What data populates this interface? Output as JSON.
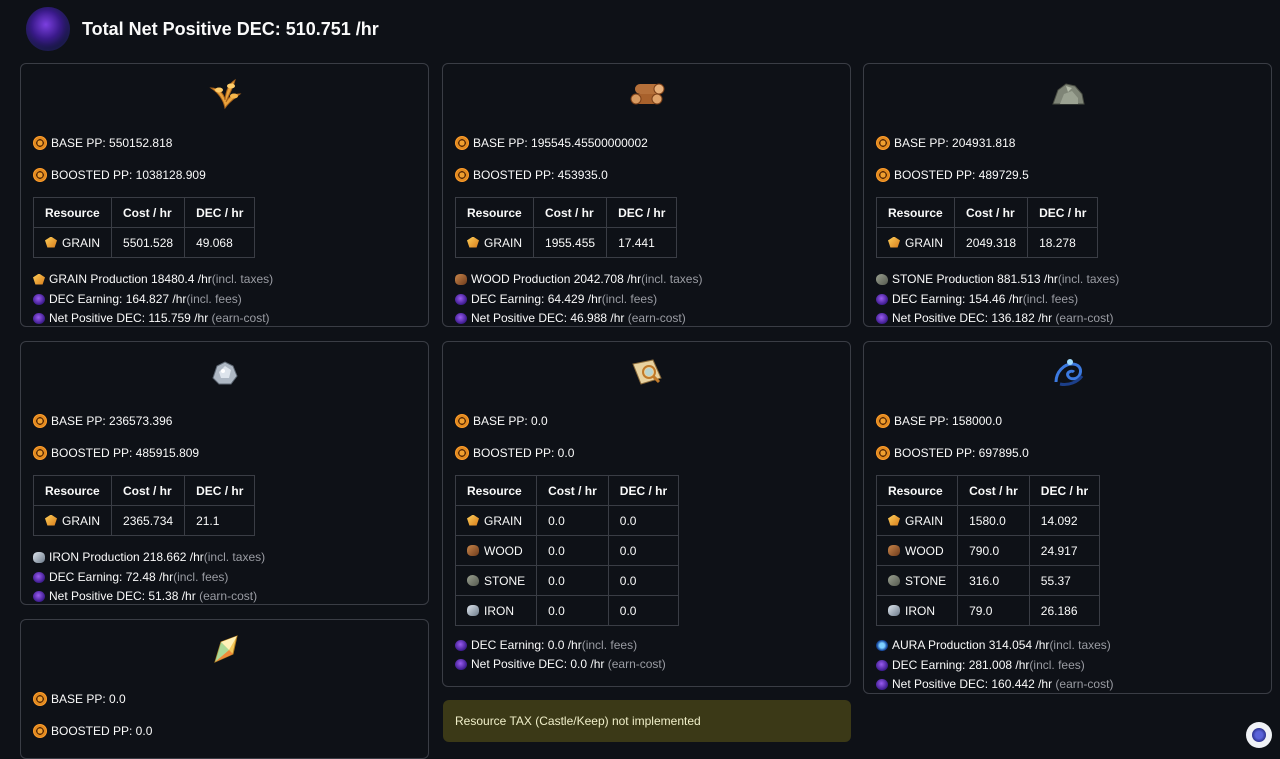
{
  "header": {
    "title": "Total Net Positive DEC: 510.751 /hr"
  },
  "table_headers": {
    "resource": "Resource",
    "cost": "Cost / hr",
    "dec": "DEC / hr"
  },
  "cards": {
    "grain": {
      "icon": "grain-icon",
      "base_pp": "BASE PP: 550152.818",
      "boosted_pp": "BOOSTED PP: 1038128.909",
      "rows": [
        {
          "resource": "GRAIN",
          "cost": "5501.528",
          "dec": "49.068"
        }
      ],
      "production": "GRAIN Production 18480.4 /hr",
      "production_note": "(incl. taxes)",
      "earning": "DEC Earning: 164.827 /hr",
      "earning_note": "(incl. fees)",
      "net": "Net Positive DEC: 115.759 /hr",
      "net_note": "(earn-cost)"
    },
    "wood": {
      "icon": "wood-icon",
      "base_pp": "BASE PP: 195545.45500000002",
      "boosted_pp": "BOOSTED PP: 453935.0",
      "rows": [
        {
          "resource": "GRAIN",
          "cost": "1955.455",
          "dec": "17.441"
        }
      ],
      "production": "WOOD Production 2042.708 /hr",
      "production_note": "(incl. taxes)",
      "earning": "DEC Earning: 64.429 /hr",
      "earning_note": "(incl. fees)",
      "net": "Net Positive DEC: 46.988 /hr",
      "net_note": "(earn-cost)"
    },
    "stone": {
      "icon": "stone-icon",
      "base_pp": "BASE PP: 204931.818",
      "boosted_pp": "BOOSTED PP: 489729.5",
      "rows": [
        {
          "resource": "GRAIN",
          "cost": "2049.318",
          "dec": "18.278"
        }
      ],
      "production": "STONE Production 881.513 /hr",
      "production_note": "(incl. taxes)",
      "earning": "DEC Earning: 154.46 /hr",
      "earning_note": "(incl. fees)",
      "net": "Net Positive DEC: 136.182 /hr",
      "net_note": "(earn-cost)"
    },
    "iron": {
      "icon": "iron-icon",
      "base_pp": "BASE PP: 236573.396",
      "boosted_pp": "BOOSTED PP: 485915.809",
      "rows": [
        {
          "resource": "GRAIN",
          "cost": "2365.734",
          "dec": "21.1"
        }
      ],
      "production": "IRON Production 218.662 /hr",
      "production_note": "(incl. taxes)",
      "earning": "DEC Earning: 72.48 /hr",
      "earning_note": "(incl. fees)",
      "net": "Net Positive DEC: 51.38 /hr",
      "net_note": "(earn-cost)"
    },
    "research": {
      "icon": "research-scroll-icon",
      "base_pp": "BASE PP: 0.0",
      "boosted_pp": "BOOSTED PP: 0.0",
      "rows": [
        {
          "resource": "GRAIN",
          "cost": "0.0",
          "dec": "0.0"
        },
        {
          "resource": "WOOD",
          "cost": "0.0",
          "dec": "0.0"
        },
        {
          "resource": "STONE",
          "cost": "0.0",
          "dec": "0.0"
        },
        {
          "resource": "IRON",
          "cost": "0.0",
          "dec": "0.0"
        }
      ],
      "earning": "DEC Earning: 0.0 /hr",
      "earning_note": "(incl. fees)",
      "net": "Net Positive DEC: 0.0 /hr",
      "net_note": "(earn-cost)"
    },
    "aura": {
      "icon": "aura-icon",
      "base_pp": "BASE PP: 158000.0",
      "boosted_pp": "BOOSTED PP: 697895.0",
      "rows": [
        {
          "resource": "GRAIN",
          "cost": "1580.0",
          "dec": "14.092"
        },
        {
          "resource": "WOOD",
          "cost": "790.0",
          "dec": "24.917"
        },
        {
          "resource": "STONE",
          "cost": "316.0",
          "dec": "55.37"
        },
        {
          "resource": "IRON",
          "cost": "79.0",
          "dec": "26.186"
        }
      ],
      "production": "AURA Production 314.054 /hr",
      "production_note": "(incl. taxes)",
      "earning": "DEC Earning: 281.008 /hr",
      "earning_note": "(incl. fees)",
      "net": "Net Positive DEC: 160.442 /hr",
      "net_note": "(earn-cost)"
    },
    "sps": {
      "icon": "sps-crystal-icon",
      "base_pp": "BASE PP: 0.0",
      "boosted_pp": "BOOSTED PP: 0.0"
    }
  },
  "warning": {
    "text": "Resource TAX (Castle/Keep) not implemented"
  }
}
